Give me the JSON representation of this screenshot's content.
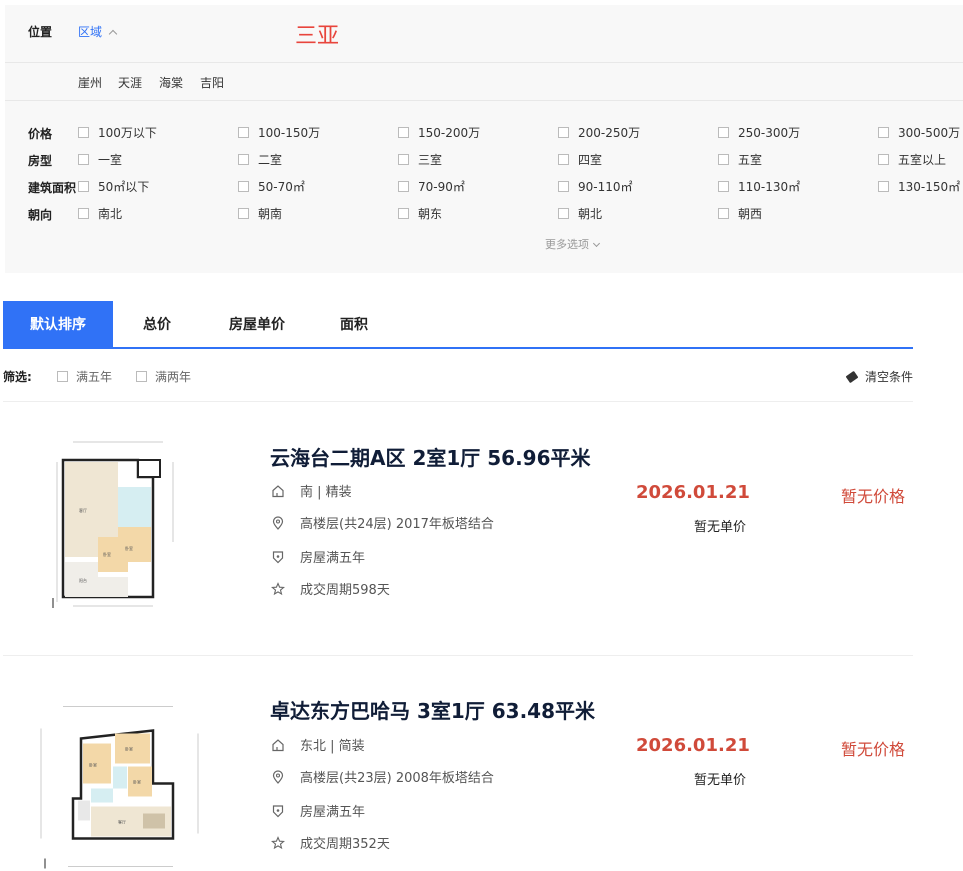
{
  "filters": {
    "location_label": "位置",
    "location_tab": "区域",
    "overlay_city": "三亚",
    "districts": [
      "崖州",
      "天涯",
      "海棠",
      "吉阳"
    ],
    "price": {
      "label": "价格",
      "options": [
        "100万以下",
        "100-150万",
        "150-200万",
        "200-250万",
        "250-300万",
        "300-500万"
      ]
    },
    "room": {
      "label": "房型",
      "options": [
        "一室",
        "二室",
        "三室",
        "四室",
        "五室",
        "五室以上"
      ]
    },
    "area": {
      "label": "建筑面积",
      "options": [
        "50㎡以下",
        "50-70㎡",
        "70-90㎡",
        "90-110㎡",
        "110-130㎡",
        "130-150㎡"
      ]
    },
    "orient": {
      "label": "朝向",
      "options": [
        "南北",
        "朝南",
        "朝东",
        "朝北",
        "朝西"
      ]
    },
    "more": "更多选项"
  },
  "sort_tabs": [
    "默认排序",
    "总价",
    "房屋单价",
    "面积"
  ],
  "screen": {
    "label": "筛选:",
    "options": [
      "满五年",
      "满两年"
    ],
    "clear": "清空条件"
  },
  "listings": [
    {
      "title": "云海台二期A区 2室1厅 56.96平米",
      "orientation": "南 | 精装",
      "floor": "高楼层(共24层) 2017年板塔结合",
      "tag": "房屋满五年",
      "cycle": "成交周期598天",
      "date": "2026.01.21",
      "unit_price": "暂无单价",
      "price": "暂无价格"
    },
    {
      "title": "卓达东方巴哈马 3室1厅 63.48平米",
      "orientation": "东北 | 简装",
      "floor": "高楼层(共23层) 2008年板塔结合",
      "tag": "房屋满五年",
      "cycle": "成交周期352天",
      "date": "2026.01.21",
      "unit_price": "暂无单价",
      "price": "暂无价格"
    }
  ],
  "icons": {
    "orientation": "home-icon",
    "floor": "location-pin-icon",
    "tag": "shield-icon",
    "cycle": "star-icon"
  },
  "colors": {
    "accent": "#3072f6",
    "price": "#d04a3a",
    "title": "#101d37"
  }
}
